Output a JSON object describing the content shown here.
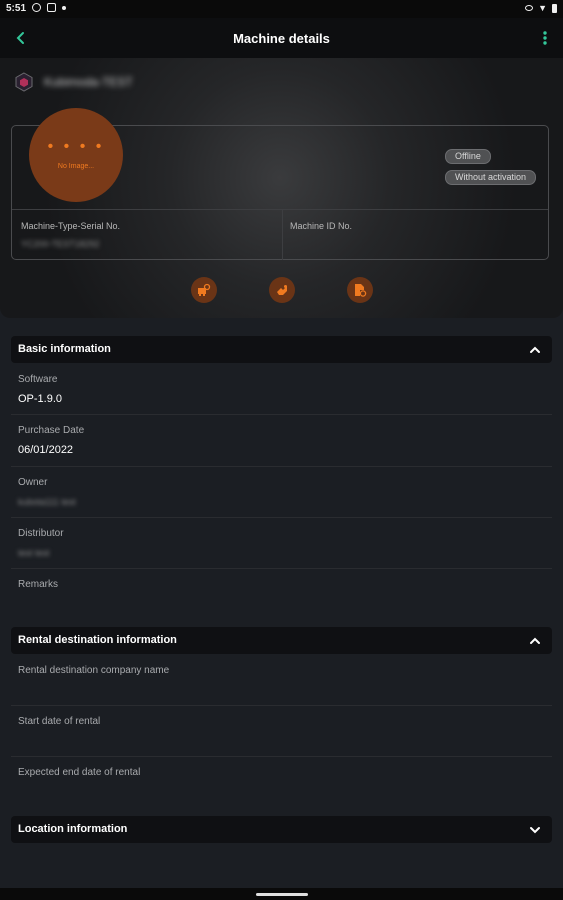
{
  "status_bar": {
    "time": "5:51"
  },
  "app_bar": {
    "title": "Machine details"
  },
  "machine": {
    "name": "Kubimoda-TEST",
    "image_placeholder": "No Image...",
    "status_chip_1": "Offline",
    "status_chip_2": "Without activation",
    "serial_label": "Machine-Type-Serial No.",
    "serial_value": "YC200-TEST18292",
    "machine_id_label": "Machine ID No."
  },
  "basic_info": {
    "title": "Basic information",
    "software_label": "Software",
    "software_value": "OP-1.9.0",
    "purchase_date_label": "Purchase Date",
    "purchase_date_value": "06/01/2022",
    "owner_label": "Owner",
    "owner_value": "kubota111 test",
    "distributor_label": "Distributor",
    "distributor_value": "test test",
    "remarks_label": "Remarks"
  },
  "rental_info": {
    "title": "Rental destination information",
    "company_label": "Rental destination company name",
    "start_label": "Start date of rental",
    "end_label": "Expected end date of rental"
  },
  "location_info": {
    "title": "Location information"
  },
  "colors": {
    "accent": "#f07a20",
    "accent_dark": "#6a3416",
    "background": "#1b1e23",
    "header": "#0d0e10"
  }
}
